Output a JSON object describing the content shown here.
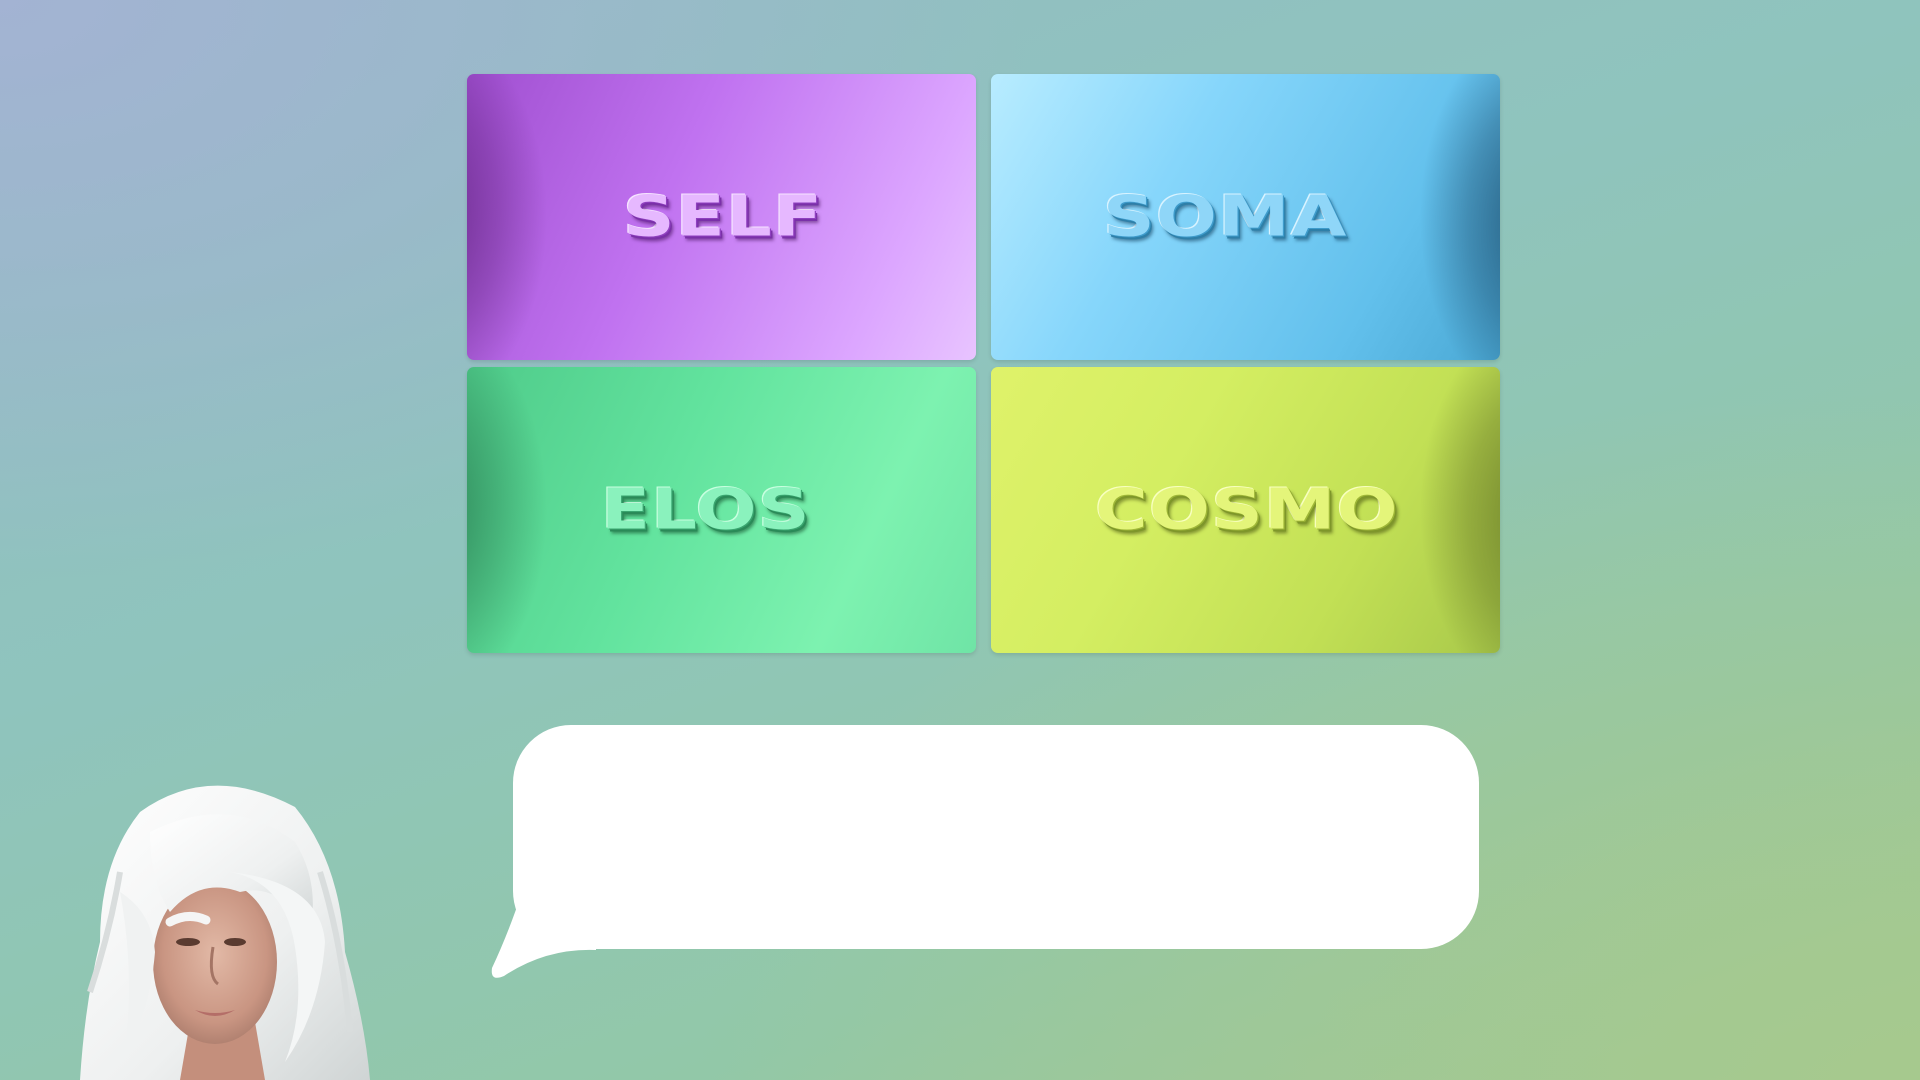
{
  "tiles": [
    {
      "id": "self",
      "label": "SELF",
      "color": "#c072f0"
    },
    {
      "id": "soma",
      "label": "SOMA",
      "color": "#86d6fb"
    },
    {
      "id": "elos",
      "label": "ELOS",
      "color": "#62e39e"
    },
    {
      "id": "cosmo",
      "label": "COSMO",
      "color": "#d4ee62"
    }
  ],
  "speech_bubble": {
    "text": ""
  },
  "avatar": {
    "icon": "avatar-woman-white-hair"
  }
}
